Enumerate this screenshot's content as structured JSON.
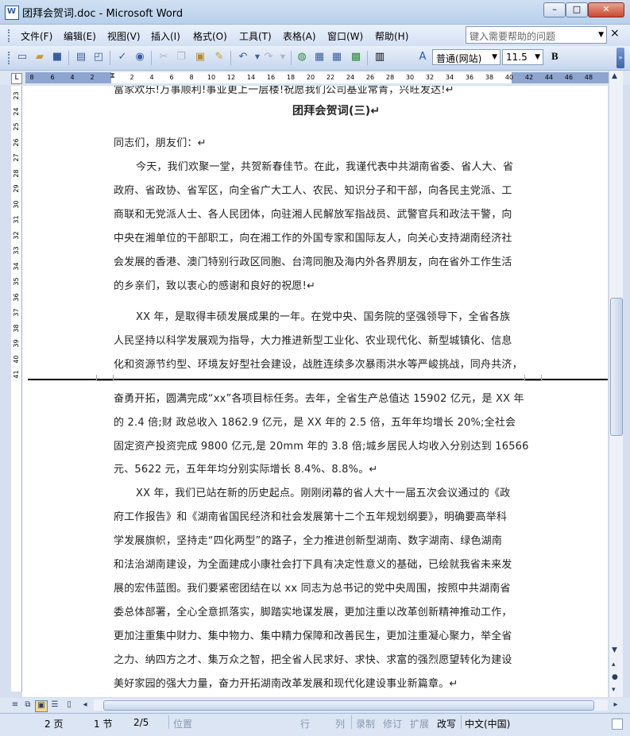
{
  "window": {
    "title": "团拜会贺词.doc - Microsoft Word",
    "app_icon_glyph": "W",
    "controls": {
      "minimize": "–",
      "maximize": "□",
      "close": "✕"
    }
  },
  "menubar": {
    "items": [
      "文件(F)",
      "编辑(E)",
      "视图(V)",
      "插入(I)",
      "格式(O)",
      "工具(T)",
      "表格(A)",
      "窗口(W)",
      "帮助(H)"
    ],
    "help_placeholder": "键入需要帮助的问题",
    "close_glyph": "×"
  },
  "toolbar": {
    "style_value": "普通(网站)",
    "font_size_value": "11.5",
    "bold_label": "B",
    "icons": [
      "new-document-icon",
      "open-folder-icon",
      "save-icon",
      "print-icon",
      "print-preview-icon",
      "spelling-icon",
      "research-icon",
      "cut-icon",
      "copy-icon",
      "paste-icon",
      "format-painter-icon",
      "undo-icon",
      "redo-icon",
      "hyperlink-icon",
      "tables-borders-icon",
      "insert-table-icon",
      "insert-excel-icon",
      "columns-icon",
      "styles-formatting-icon"
    ]
  },
  "ruler": {
    "labels": [
      "8",
      "6",
      "4",
      "2",
      "2",
      "4",
      "6",
      "8",
      "10",
      "12",
      "14",
      "16",
      "18",
      "20",
      "22",
      "24",
      "26",
      "28",
      "30",
      "32",
      "34",
      "36",
      "38",
      "40",
      "42",
      "44",
      "46",
      "48"
    ]
  },
  "vertical_ruler": {
    "labels": [
      "23",
      "24",
      "25",
      "26",
      "27",
      "28",
      "29",
      "30",
      "31",
      "32",
      "33",
      "34",
      "35",
      "36",
      "37",
      "38",
      "39",
      "40",
      "41"
    ]
  },
  "document": {
    "lines": [
      "富家欢乐!万事顺利!事业更上一层楼!祝愿我们公司基业常青，兴旺发达!↵",
      "团拜会贺词(三)↵",
      "同志们，朋友们：↵",
      "今天，我们欢聚一堂，共贺新春佳节。在此，我谨代表中共湖南省委、省人大、省",
      "政府、省政协、省军区，向全省广大工人、农民、知识分子和干部，向各民主党派、工",
      "商联和无党派人士、各人民团体，向驻湘人民解放军指战员、武警官兵和政法干警，向",
      "中央在湘单位的干部职工，向在湘工作的外国专家和国际友人，向关心支持湖南经济社",
      "会发展的香港、澳门特别行政区同胞、台湾同胞及海内外各界朋友，向在省外工作生活",
      "的乡亲们，致以衷心的感谢和良好的祝愿!↵",
      "XX 年，是取得丰硕发展成果的一年。在党中央、国务院的坚强领导下，全省各族",
      "人民坚持以科学发展观为指导，大力推进新型工业化、农业现代化、新型城镇化、信息",
      "化和资源节约型、环境友好型社会建设，战胜连续多次暴雨洪水等严峻挑战，同舟共济，",
      "奋勇开拓，圆满完成“xx”各项目标任务。去年，全省生产总值达 15902 亿元，是 XX 年",
      "的 2.4 倍;财 政总收入 1862.9 亿元，是 XX 年的 2.5 倍，五年年均增长 20%;全社会",
      "固定资产投资完成 9800 亿元,是 20mm 年的 3.8 倍;城乡居民人均收入分别达到 16566",
      "元、5622 元，五年年均分别实际增长 8.4%、8.8%。↵",
      "XX 年，我们已站在新的历史起点。刚刚闭幕的省人大十一届五次会议通过的《政",
      "府工作报告》和《湖南省国民经济和社会发展第十二个五年规划纲要》，明确要高举科",
      "学发展旗帜，坚持走“四化两型”的路子，全力推进创新型湖南、数字湖南、绿色湖南",
      "和法治湖南建设，为全面建成小康社会打下具有决定性意义的基础，已绘就我省未来发",
      "展的宏伟蓝图。我们要紧密团结在以 xx 同志为总书记的党中央周围，按照中共湖南省",
      "委总体部署，全心全意抓落实，脚踏实地谋发展，更加注重以改革创新精神推动工作，",
      "更加注重集中财力、集中物力、集中精力保障和改善民生，更加注重凝心聚力，举全省",
      "之力、纳四方之才、集万众之智，把全省人民求好、求快、求富的强烈愿望转化为建设",
      "美好家园的强大力量，奋力开拓湖南改革发展和现代化建设事业新篇章。↵"
    ]
  },
  "statusbar": {
    "page": "2 页",
    "section": "1 节",
    "page_of": "2/5",
    "position": "位置",
    "line": "行",
    "column": "列",
    "rec": "录制",
    "trk": "修订",
    "ext": "扩展",
    "ovr": "改写",
    "language": "中文(中国)"
  }
}
